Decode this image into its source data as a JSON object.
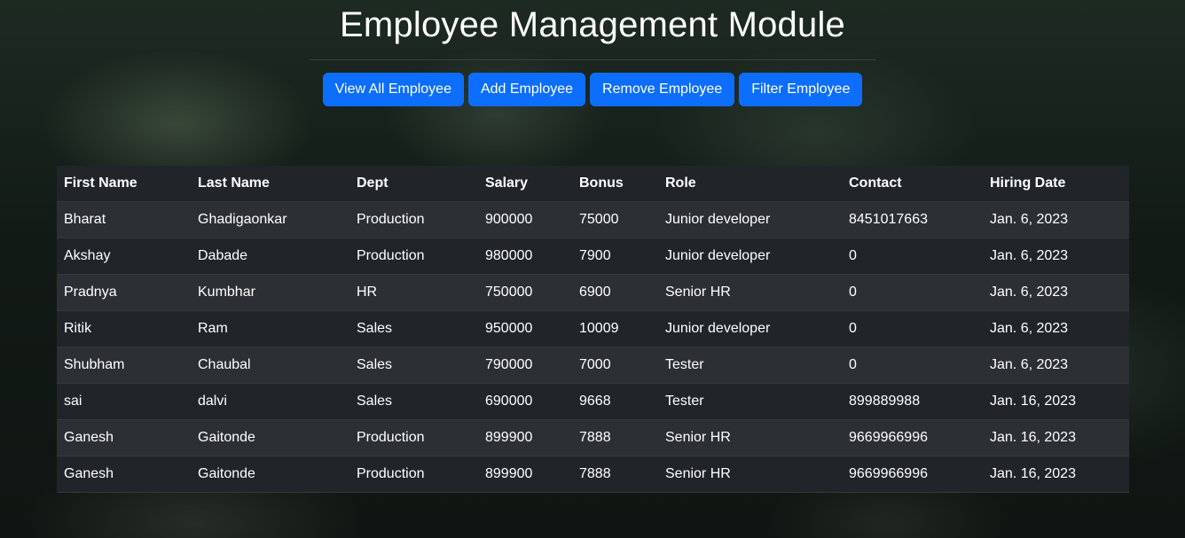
{
  "header": {
    "title": "Employee Management Module"
  },
  "actions": [
    {
      "label": "View All Employee"
    },
    {
      "label": "Add Employee"
    },
    {
      "label": "Remove Employee"
    },
    {
      "label": "Filter Employee"
    }
  ],
  "table": {
    "columns": [
      "First Name",
      "Last Name",
      "Dept",
      "Salary",
      "Bonus",
      "Role",
      "Contact",
      "Hiring Date"
    ],
    "rows": [
      [
        "Bharat",
        "Ghadigaonkar",
        "Production",
        "900000",
        "75000",
        "Junior developer",
        "8451017663",
        "Jan. 6, 2023"
      ],
      [
        "Akshay",
        "Dabade",
        "Production",
        "980000",
        "7900",
        "Junior developer",
        "0",
        "Jan. 6, 2023"
      ],
      [
        "Pradnya",
        "Kumbhar",
        "HR",
        "750000",
        "6900",
        "Senior HR",
        "0",
        "Jan. 6, 2023"
      ],
      [
        "Ritik",
        "Ram",
        "Sales",
        "950000",
        "10009",
        "Junior developer",
        "0",
        "Jan. 6, 2023"
      ],
      [
        "Shubham",
        "Chaubal",
        "Sales",
        "790000",
        "7000",
        "Tester",
        "0",
        "Jan. 6, 2023"
      ],
      [
        "sai",
        "dalvi",
        "Sales",
        "690000",
        "9668",
        "Tester",
        "899889988",
        "Jan. 16, 2023"
      ],
      [
        "Ganesh",
        "Gaitonde",
        "Production",
        "899900",
        "7888",
        "Senior HR",
        "9669966996",
        "Jan. 16, 2023"
      ],
      [
        "Ganesh",
        "Gaitonde",
        "Production",
        "899900",
        "7888",
        "Senior HR",
        "9669966996",
        "Jan. 16, 2023"
      ]
    ]
  },
  "colors": {
    "primary_button": "#0d6efd",
    "table_header_bg": "#212529",
    "table_row_striped_bg": "#2c3034",
    "text": "#ffffff"
  }
}
